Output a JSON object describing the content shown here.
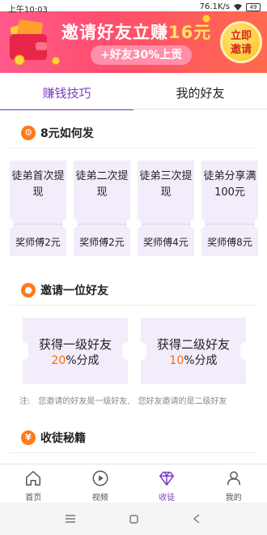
{
  "status_bar": {
    "time": "上午10:03",
    "speed": "76.1K/s",
    "battery": "49"
  },
  "banner": {
    "title_prefix": "邀请好友立赚",
    "title_amount": "16元",
    "subtitle": "+好友30%上贡",
    "cta_line1": "立即",
    "cta_line2": "邀请"
  },
  "tabs": [
    {
      "label": "赚钱技巧",
      "active": true
    },
    {
      "label": "我的好友",
      "active": false
    }
  ],
  "section1": {
    "title": "8元如何发",
    "cards": [
      {
        "main": "徒弟首次提现",
        "reward": "奖师傅2元"
      },
      {
        "main": "徒弟二次提现",
        "reward": "奖师傅2元"
      },
      {
        "main": "徒弟三次提现",
        "reward": "奖师傅4元"
      },
      {
        "main": "徒弟分享满100元",
        "reward": "奖师傅8元"
      }
    ]
  },
  "section2": {
    "title": "邀请一位好友",
    "tickets": [
      {
        "line1": "获得一级好友",
        "pct": "20",
        "suffix": "%分成"
      },
      {
        "line1": "获得二级好友",
        "pct": "10",
        "suffix": "%分成"
      }
    ],
    "note_label": "注:",
    "note_part1": "您邀请的好友是一级好友,",
    "note_part2": "您好友邀请的是二级好友"
  },
  "section3": {
    "title": "收徒秘籍"
  },
  "bottom_nav": [
    {
      "label": "首页",
      "icon": "home-icon",
      "active": false
    },
    {
      "label": "视频",
      "icon": "play-icon",
      "active": false
    },
    {
      "label": "收徒",
      "icon": "diamond-icon",
      "active": true
    },
    {
      "label": "我的",
      "icon": "person-icon",
      "active": false
    }
  ],
  "colors": {
    "accent": "#7b3fbf",
    "highlight": "#ff6a00",
    "banner": "#ff4d6d",
    "card_bg": "#f3ecfb"
  }
}
